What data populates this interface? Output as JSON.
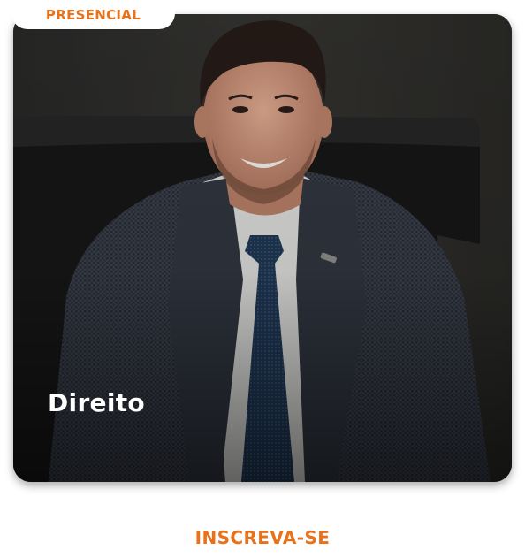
{
  "badge": {
    "label": "PRESENCIAL"
  },
  "card": {
    "title": "Direito"
  },
  "cta": {
    "label": "INSCREVA-SE"
  },
  "colors": {
    "accent": "#e8711c",
    "card_text": "#ffffff",
    "background": "#ffffff"
  },
  "photo": {
    "subject": "smiling man in checked suit and blue tie seated in a dark leather chair"
  }
}
